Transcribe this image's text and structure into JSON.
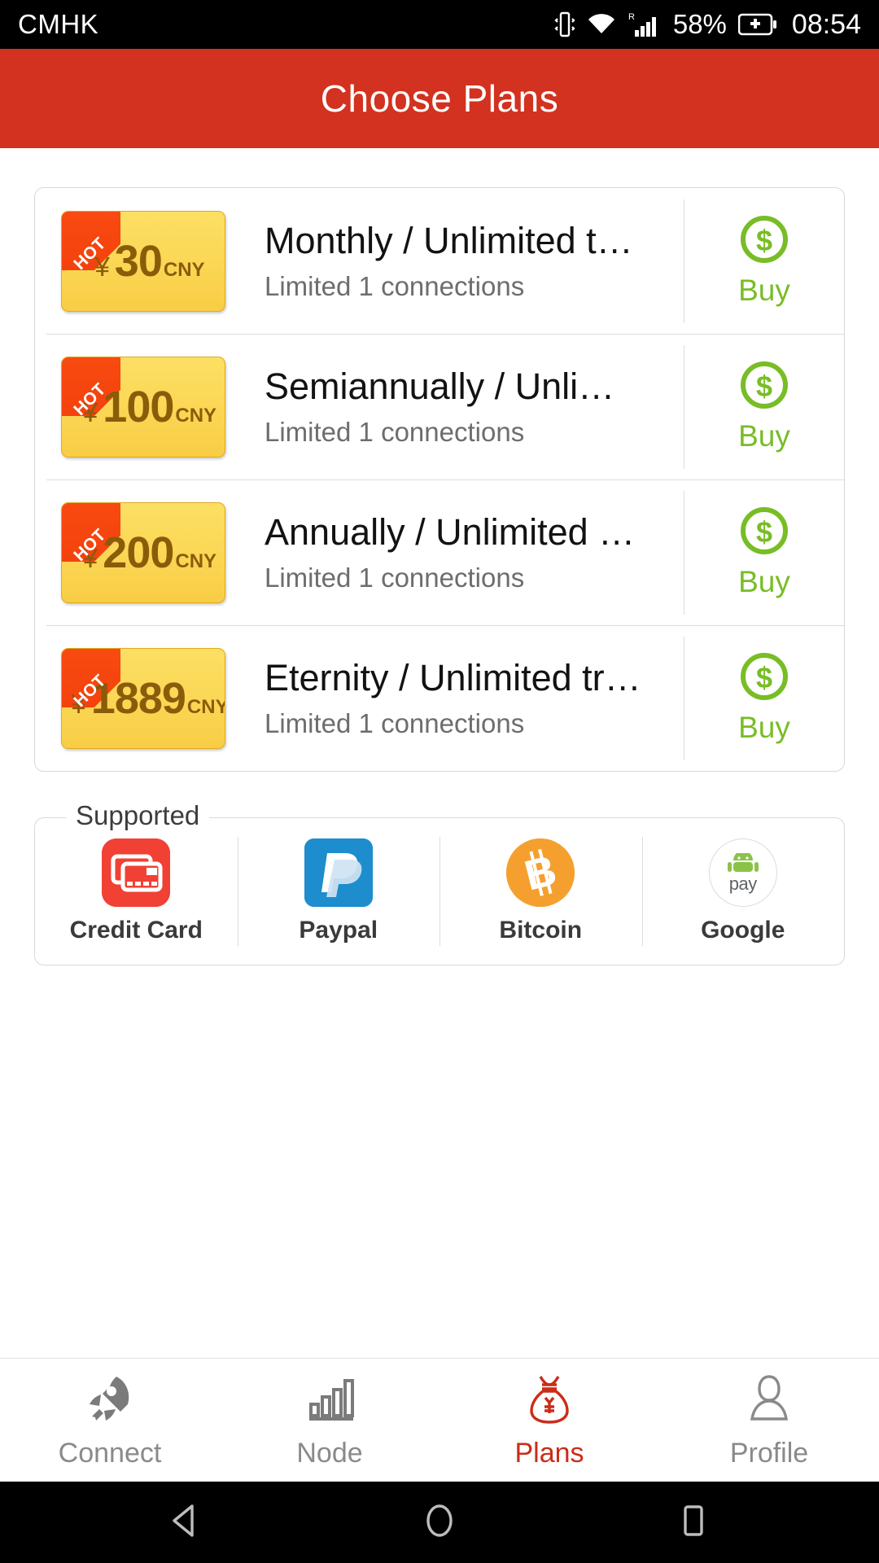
{
  "status_bar": {
    "carrier": "CMHK",
    "battery_percent": "58%",
    "time": "08:54",
    "roaming_label": "R",
    "icons": [
      "vibrate-icon",
      "wifi-icon",
      "signal-icon",
      "battery-charging-icon"
    ]
  },
  "header": {
    "title": "Choose Plans"
  },
  "plans": [
    {
      "badge": "HOT",
      "currency_symbol": "¥",
      "amount": "30",
      "currency_code": "CNY",
      "title": "Monthly / Unlimited t…",
      "subtitle": "Limited 1 connections",
      "buy_label": "Buy"
    },
    {
      "badge": "HOT",
      "currency_symbol": "¥",
      "amount": "100",
      "currency_code": "CNY",
      "title": "Semiannually / Unli…",
      "subtitle": "Limited 1 connections",
      "buy_label": "Buy"
    },
    {
      "badge": "HOT",
      "currency_symbol": "¥",
      "amount": "200",
      "currency_code": "CNY",
      "title": "Annually / Unlimited …",
      "subtitle": "Limited 1 connections",
      "buy_label": "Buy"
    },
    {
      "badge": "HOT",
      "currency_symbol": "¥",
      "amount": "1889",
      "currency_code": "CNY",
      "title": "Eternity / Unlimited tr…",
      "subtitle": "Limited 1 connections",
      "buy_label": "Buy"
    }
  ],
  "supported": {
    "legend": "Supported",
    "methods": [
      {
        "label": "Credit Card",
        "icon": "credit-card-icon"
      },
      {
        "label": "Paypal",
        "icon": "paypal-icon"
      },
      {
        "label": "Bitcoin",
        "icon": "bitcoin-icon"
      },
      {
        "label": "Google",
        "icon": "google-pay-icon",
        "sub": "pay"
      }
    ]
  },
  "bottom_nav": {
    "items": [
      {
        "label": "Connect",
        "icon": "rocket-icon",
        "active": false
      },
      {
        "label": "Node",
        "icon": "bar-chart-icon",
        "active": false
      },
      {
        "label": "Plans",
        "icon": "money-bag-icon",
        "active": true
      },
      {
        "label": "Profile",
        "icon": "person-icon",
        "active": false
      }
    ]
  },
  "android_nav": {
    "back": "back-triangle-icon",
    "home": "home-circle-icon",
    "recents": "recents-square-icon"
  },
  "colors": {
    "header_red": "#d2321f",
    "accent_green": "#78bd26",
    "badge_gold": "#fbd857",
    "hot_orange": "#f33f0c",
    "active_red": "#cc2c18"
  }
}
